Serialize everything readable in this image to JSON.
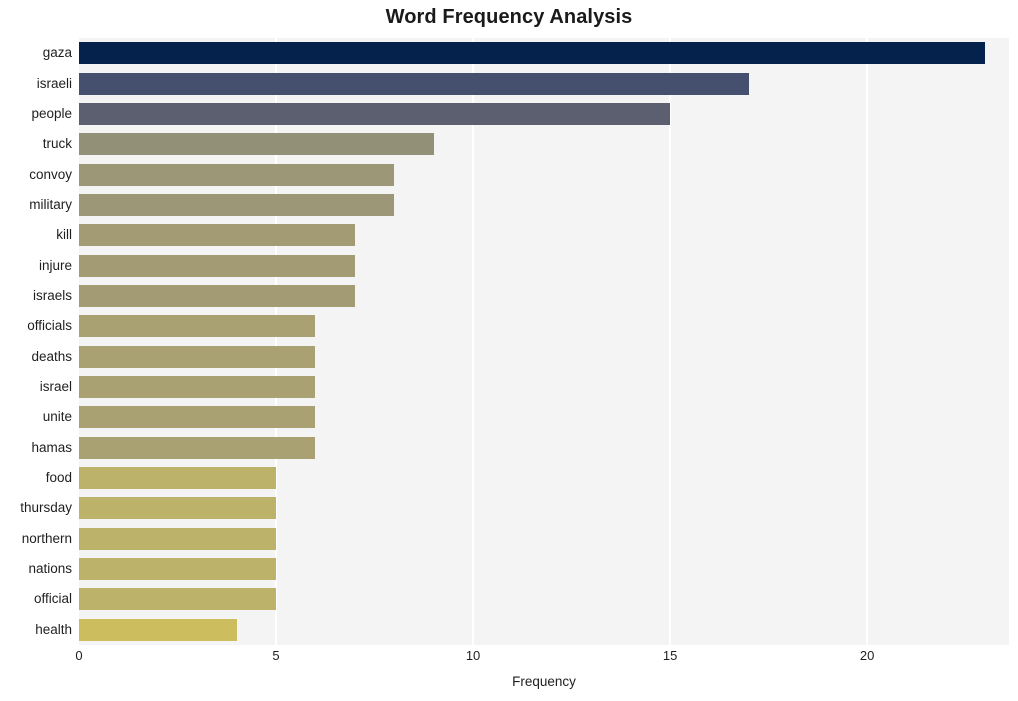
{
  "chart_data": {
    "type": "bar",
    "orientation": "horizontal",
    "title": "Word Frequency Analysis",
    "xlabel": "Frequency",
    "ylabel": "",
    "xlim": [
      0,
      23.6
    ],
    "xticks": [
      0,
      5,
      10,
      15,
      20
    ],
    "xtick_labels": [
      "0",
      "5",
      "10",
      "15",
      "20"
    ],
    "grid": "vertical",
    "legend": "none",
    "categories": [
      "gaza",
      "israeli",
      "people",
      "truck",
      "convoy",
      "military",
      "kill",
      "injure",
      "israels",
      "officials",
      "deaths",
      "israel",
      "unite",
      "hamas",
      "food",
      "thursday",
      "northern",
      "nations",
      "official",
      "health"
    ],
    "values": [
      23,
      17,
      15,
      9,
      8,
      8,
      7,
      7,
      7,
      6,
      6,
      6,
      6,
      6,
      5,
      5,
      5,
      5,
      5,
      4
    ],
    "bar_colors": [
      "#04224c",
      "#454f6e",
      "#5b5f70",
      "#939078",
      "#9b9777",
      "#9b9777",
      "#a29b73",
      "#a29b73",
      "#a29b73",
      "#aaa172",
      "#aaa172",
      "#aaa172",
      "#aaa172",
      "#aaa172",
      "#bdb269",
      "#bdb269",
      "#bdb269",
      "#bdb269",
      "#bdb269",
      "#ccbe5e"
    ],
    "plot_bgcolor": "#f4f4f5",
    "gridline_color": "#ffffff",
    "page_bgcolor": "#ffffff",
    "text_color": "#1f1f1f"
  }
}
